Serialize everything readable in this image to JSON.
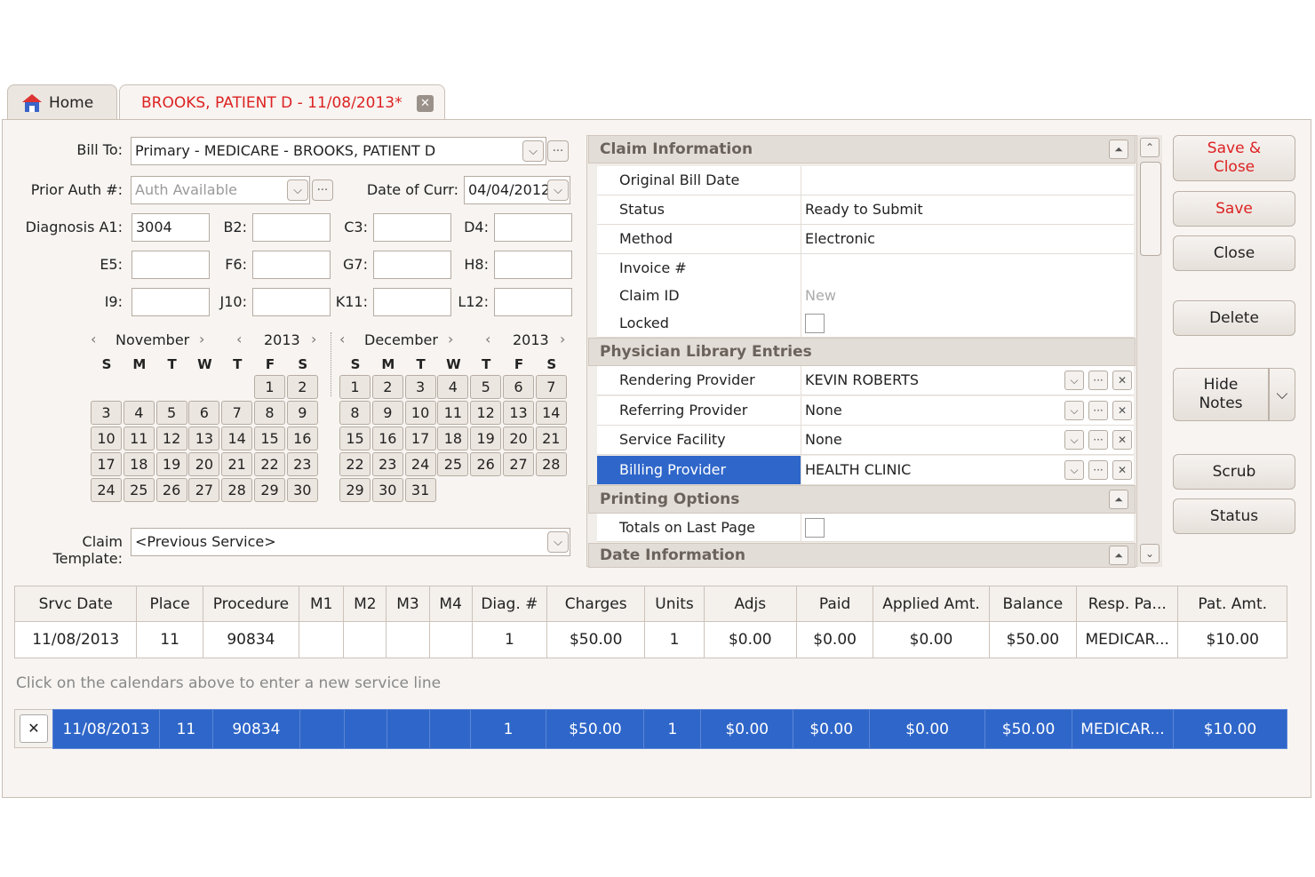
{
  "tabs": {
    "home": "Home",
    "patient": "BROOKS, PATIENT D - 11/08/2013*"
  },
  "form": {
    "bill_to_label": "Bill To:",
    "bill_to_value": "Primary - MEDICARE - BROOKS, PATIENT D",
    "prior_auth_label": "Prior Auth #:",
    "prior_auth_placeholder": "Auth Available",
    "date_curr_label": "Date of Curr:",
    "date_curr_value": "04/04/2012",
    "diag_labels": [
      "Diagnosis A1:",
      "B2:",
      "C3:",
      "D4:",
      "E5:",
      "F6:",
      "G7:",
      "H8:",
      "I9:",
      "J10:",
      "K11:",
      "L12:"
    ],
    "diag_values": [
      "3004",
      "",
      "",
      "",
      "",
      "",
      "",
      "",
      "",
      "",
      "",
      ""
    ],
    "claim_template_label": "Claim Template:",
    "claim_template_value": "<Previous Service>",
    "ellipsis": "···"
  },
  "calendars": [
    {
      "month": "November",
      "year": "2013",
      "first_col": 5,
      "days": 30
    },
    {
      "month": "December",
      "year": "2013",
      "first_col": 0,
      "days": 31
    }
  ],
  "dow": [
    "S",
    "M",
    "T",
    "W",
    "T",
    "F",
    "S"
  ],
  "claim_info": {
    "title": "Claim Information",
    "rows": [
      {
        "k": "Original Bill Date",
        "v": ""
      },
      {
        "k": "Status",
        "v": "Ready to Submit"
      },
      {
        "k": "Method",
        "v": "Electronic"
      },
      {
        "k": "Invoice #",
        "v": ""
      },
      {
        "k": "Claim ID",
        "v": "New"
      },
      {
        "k": "Locked",
        "v": ""
      }
    ]
  },
  "physician": {
    "title": "Physician Library Entries",
    "rows": [
      {
        "k": "Rendering Provider",
        "v": "KEVIN ROBERTS"
      },
      {
        "k": "Referring Provider",
        "v": "None"
      },
      {
        "k": "Service Facility",
        "v": "None"
      },
      {
        "k": "Billing Provider",
        "v": "HEALTH CLINIC"
      }
    ]
  },
  "printing": {
    "title": "Printing Options",
    "row": "Totals on Last Page"
  },
  "date_info": {
    "title": "Date Information"
  },
  "buttons": {
    "save_close": "Save &\nClose",
    "save": "Save",
    "close": "Close",
    "delete": "Delete",
    "hide_notes": "Hide\nNotes",
    "scrub": "Scrub",
    "status": "Status"
  },
  "table": {
    "headers": [
      "Srvc Date",
      "Place",
      "Procedure",
      "M1",
      "M2",
      "M3",
      "M4",
      "Diag. #",
      "Charges",
      "Units",
      "Adjs",
      "Paid",
      "Applied Amt.",
      "Balance",
      "Resp. Pa...",
      "Pat. Amt."
    ],
    "row": [
      "11/08/2013",
      "11",
      "90834",
      "",
      "",
      "",
      "",
      "1",
      "$50.00",
      "1",
      "$0.00",
      "$0.00",
      "$0.00",
      "$50.00",
      "MEDICAR...",
      "$10.00"
    ]
  },
  "hint": "Click on the calendars above to enter a new service line",
  "service_line": [
    "11/08/2013",
    "11",
    "90834",
    "",
    "",
    "",
    "",
    "1",
    "$50.00",
    "1",
    "$0.00",
    "$0.00",
    "$0.00",
    "$50.00",
    "MEDICAR...",
    "$10.00"
  ],
  "remove_glyph": "✕"
}
